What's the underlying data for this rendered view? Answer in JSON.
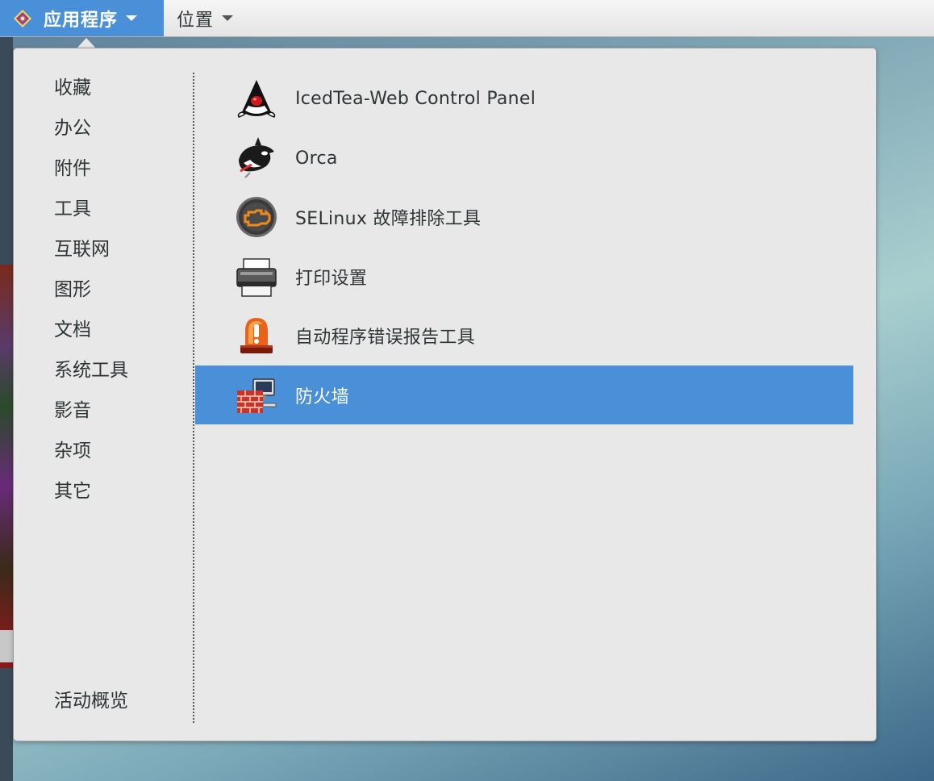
{
  "top_bar": {
    "applications_label": "应用程序",
    "places_label": "位置"
  },
  "menu": {
    "categories": [
      {
        "label": "收藏"
      },
      {
        "label": "办公"
      },
      {
        "label": "附件"
      },
      {
        "label": "工具"
      },
      {
        "label": "互联网"
      },
      {
        "label": "图形"
      },
      {
        "label": "文档"
      },
      {
        "label": "系统工具"
      },
      {
        "label": "影音"
      },
      {
        "label": "杂项"
      },
      {
        "label": "其它"
      }
    ],
    "activities_label": "活动概览",
    "apps": [
      {
        "label": "IcedTea-Web Control Panel",
        "icon": "java-duke-icon"
      },
      {
        "label": "Orca",
        "icon": "orca-whale-icon"
      },
      {
        "label": "SELinux 故障排除工具",
        "icon": "selinux-troubleshooter-icon"
      },
      {
        "label": "打印设置",
        "icon": "printer-icon"
      },
      {
        "label": "自动程序错误报告工具",
        "icon": "alarm-siren-icon"
      },
      {
        "label": "防火墙",
        "icon": "firewall-icon",
        "selected": true
      }
    ]
  },
  "colors": {
    "accent": "#4a90d9",
    "menu_background": "#e8e8e8",
    "text": "#2e3436"
  }
}
